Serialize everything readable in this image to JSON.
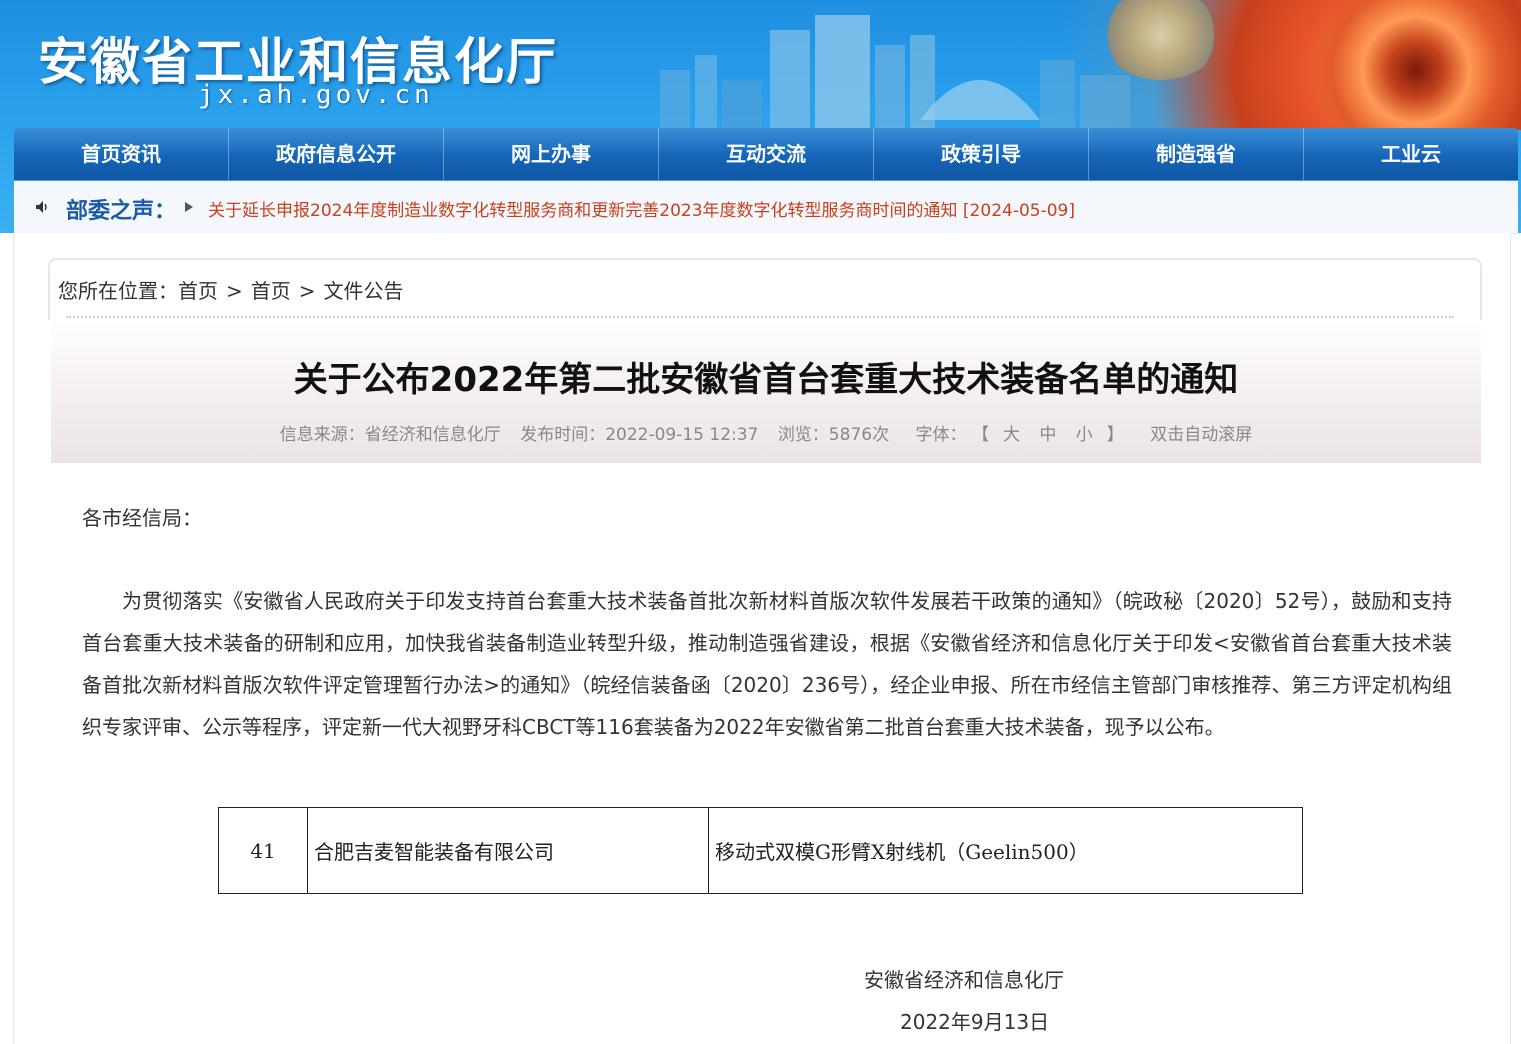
{
  "site": {
    "title": "安徽省工业和信息化厅",
    "url": "jx.ah.gov.cn"
  },
  "nav": {
    "items": [
      "首页资讯",
      "政府信息公开",
      "网上办事",
      "互动交流",
      "政策引导",
      "制造强省",
      "工业云"
    ]
  },
  "notice": {
    "label": "部委之声：",
    "link_text": "关于延长申报2024年度制造业数字化转型服务商和更新完善2023年度数字化转型服务商时间的通知 [2024-05-09]"
  },
  "breadcrumb": {
    "prefix": "您所在位置：",
    "items": [
      "首页",
      "首页",
      "文件公告"
    ],
    "separator": ">"
  },
  "article": {
    "title": "关于公布2022年第二批安徽省首台套重大技术装备名单的通知",
    "meta": {
      "source": "信息来源：省经济和信息化厅",
      "published": "发布时间：2022-09-15 12:37",
      "views": "浏览：5876次",
      "font_label": "字体：",
      "font_size_open": "【",
      "font_large": "大",
      "font_medium": "中",
      "font_small": "小",
      "font_size_close": "】",
      "auto_scroll": "双击自动滚屏"
    },
    "salutation": "各市经信局：",
    "body": "为贯彻落实《安徽省人民政府关于印发支持首台套重大技术装备首批次新材料首版次软件发展若干政策的通知》（皖政秘〔2020〕52号），鼓励和支持首台套重大技术装备的研制和应用，加快我省装备制造业转型升级，推动制造强省建设，根据《安徽省经济和信息化厅关于印发<安徽省首台套重大技术装备首批次新材料首版次软件评定管理暂行办法>的通知》（皖经信装备函〔2020〕236号），经企业申报、所在市经信主管部门审核推荐、第三方评定机构组织专家评审、公示等程序，评定新一代大视野牙科CBCT等116套装备为2022年安徽省第二批首台套重大技术装备，现予以公布。",
    "table": {
      "rows": [
        {
          "no": "41",
          "company": "合肥吉麦智能装备有限公司",
          "equipment": "移动式双模G形臂X射线机（Geelin500）"
        }
      ]
    },
    "signature": {
      "org": "安徽省经济和信息化厅",
      "date": "2022年9月13日"
    }
  }
}
